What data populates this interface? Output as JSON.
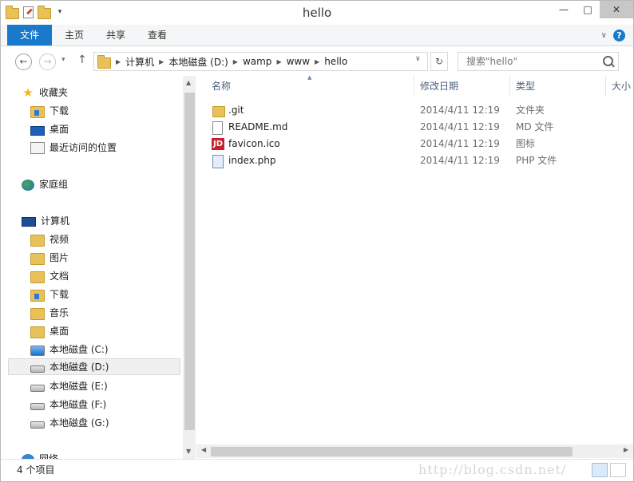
{
  "window": {
    "title": "hello"
  },
  "ribbon": {
    "tabs": [
      "文件",
      "主页",
      "共享",
      "查看"
    ]
  },
  "address": {
    "crumbs": [
      "计算机",
      "本地磁盘 (D:)",
      "wamp",
      "www",
      "hello"
    ]
  },
  "search": {
    "placeholder": "搜索\"hello\""
  },
  "nav": {
    "favorites_label": "收藏夹",
    "favorites": [
      "下载",
      "桌面",
      "最近访问的位置"
    ],
    "homegroup_label": "家庭组",
    "computer_label": "计算机",
    "computer_items": [
      "视频",
      "图片",
      "文档",
      "下载",
      "音乐",
      "桌面"
    ],
    "drives": [
      "本地磁盘 (C:)",
      "本地磁盘 (D:)",
      "本地磁盘 (E:)",
      "本地磁盘 (F:)",
      "本地磁盘 (G:)"
    ],
    "network_label": "网络"
  },
  "columns": [
    "名称",
    "修改日期",
    "类型",
    "大小"
  ],
  "files": [
    {
      "name": ".git",
      "date": "2014/4/11 12:19",
      "type": "文件夹",
      "icon": "folder-icon"
    },
    {
      "name": "README.md",
      "date": "2014/4/11 12:19",
      "type": "MD 文件",
      "icon": "document-icon"
    },
    {
      "name": "favicon.ico",
      "date": "2014/4/11 12:19",
      "type": "图标",
      "icon": "jd-image-icon"
    },
    {
      "name": "index.php",
      "date": "2014/4/11 12:19",
      "type": "PHP 文件",
      "icon": "php-file-icon"
    }
  ],
  "status": {
    "count": "4 个项目"
  },
  "watermark": "http://blog.csdn.net/"
}
